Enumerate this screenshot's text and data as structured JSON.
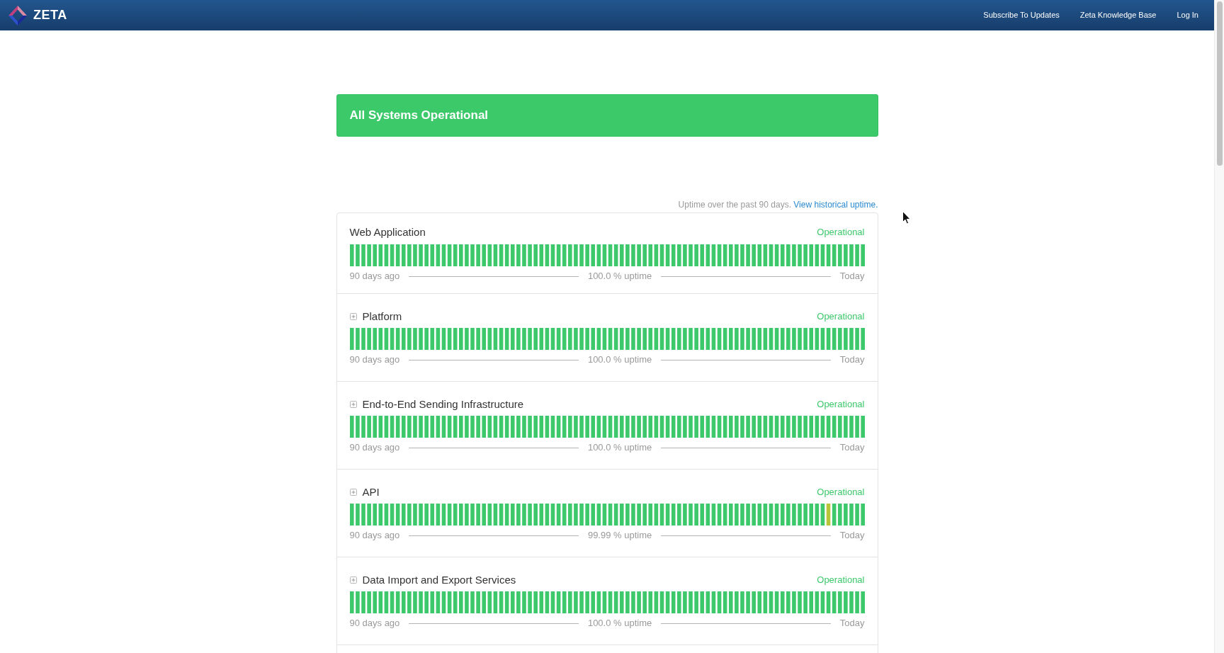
{
  "header": {
    "logo_text": "ZETA",
    "nav": [
      {
        "label": "Subscribe To Updates"
      },
      {
        "label": "Zeta Knowledge Base"
      },
      {
        "label": "Log In"
      }
    ]
  },
  "banner": {
    "text": "All Systems Operational"
  },
  "uptime_note": {
    "text": "Uptime over the past 90 days.",
    "link": "View historical uptime."
  },
  "components": [
    {
      "name": "Web Application",
      "expandable": false,
      "status": "Operational",
      "bars": [
        {
          "color": "#3dc86b"
        },
        {
          "color": "#3dc86b"
        },
        {
          "color": "#3dc86b"
        },
        {
          "color": "#3dc86b"
        },
        {
          "color": "#3dc86b"
        },
        {
          "color": "#3dc86b"
        },
        {
          "color": "#3dc86b"
        },
        {
          "color": "#3dc86b"
        },
        {
          "color": "#3dc86b"
        },
        {
          "color": "#3dc86b"
        },
        {
          "color": "#3dc86b"
        },
        {
          "color": "#3dc86b"
        },
        {
          "color": "#3dc86b"
        },
        {
          "color": "#3dc86b"
        },
        {
          "color": "#3dc86b"
        },
        {
          "color": "#3dc86b"
        },
        {
          "color": "#3dc86b"
        },
        {
          "color": "#3dc86b"
        },
        {
          "color": "#3dc86b"
        },
        {
          "color": "#3dc86b"
        },
        {
          "color": "#3dc86b"
        },
        {
          "color": "#3dc86b"
        },
        {
          "color": "#3dc86b"
        },
        {
          "color": "#3dc86b"
        },
        {
          "color": "#3dc86b"
        },
        {
          "color": "#3dc86b"
        },
        {
          "color": "#3dc86b"
        },
        {
          "color": "#3dc86b"
        },
        {
          "color": "#3dc86b"
        },
        {
          "color": "#3dc86b"
        },
        {
          "color": "#3dc86b"
        },
        {
          "color": "#3dc86b"
        },
        {
          "color": "#3dc86b"
        },
        {
          "color": "#3dc86b"
        },
        {
          "color": "#3dc86b"
        },
        {
          "color": "#3dc86b"
        },
        {
          "color": "#3dc86b"
        },
        {
          "color": "#3dc86b"
        },
        {
          "color": "#3dc86b"
        },
        {
          "color": "#3dc86b"
        },
        {
          "color": "#3dc86b"
        },
        {
          "color": "#3dc86b"
        },
        {
          "color": "#3dc86b"
        },
        {
          "color": "#3dc86b"
        },
        {
          "color": "#3dc86b"
        },
        {
          "color": "#3dc86b"
        },
        {
          "color": "#3dc86b"
        },
        {
          "color": "#3dc86b"
        },
        {
          "color": "#3dc86b"
        },
        {
          "color": "#3dc86b"
        },
        {
          "color": "#3dc86b"
        },
        {
          "color": "#3dc86b"
        },
        {
          "color": "#3dc86b"
        },
        {
          "color": "#3dc86b"
        },
        {
          "color": "#3dc86b"
        },
        {
          "color": "#3dc86b"
        },
        {
          "color": "#3dc86b"
        },
        {
          "color": "#3dc86b"
        },
        {
          "color": "#3dc86b"
        },
        {
          "color": "#3dc86b"
        },
        {
          "color": "#3dc86b"
        },
        {
          "color": "#3dc86b"
        },
        {
          "color": "#3dc86b"
        },
        {
          "color": "#3dc86b"
        },
        {
          "color": "#3dc86b"
        },
        {
          "color": "#3dc86b"
        },
        {
          "color": "#3dc86b"
        },
        {
          "color": "#3dc86b"
        },
        {
          "color": "#3dc86b"
        },
        {
          "color": "#3dc86b"
        },
        {
          "color": "#3dc86b"
        },
        {
          "color": "#3dc86b"
        },
        {
          "color": "#3dc86b"
        },
        {
          "color": "#3dc86b"
        },
        {
          "color": "#3dc86b"
        },
        {
          "color": "#3dc86b"
        },
        {
          "color": "#3dc86b"
        },
        {
          "color": "#3dc86b"
        },
        {
          "color": "#3dc86b"
        },
        {
          "color": "#3dc86b"
        },
        {
          "color": "#3dc86b"
        },
        {
          "color": "#3dc86b"
        },
        {
          "color": "#3dc86b"
        },
        {
          "color": "#3dc86b"
        },
        {
          "color": "#3dc86b"
        },
        {
          "color": "#3dc86b"
        },
        {
          "color": "#3dc86b"
        },
        {
          "color": "#3dc86b"
        },
        {
          "color": "#3dc86b"
        },
        {
          "color": "#3dc86b"
        }
      ],
      "start_label": "90 days ago",
      "uptime": "100.0 % uptime",
      "end_label": "Today"
    },
    {
      "name": "Platform",
      "expandable": true,
      "status": "Operational",
      "bars": [
        {
          "color": "#3dc86b"
        },
        {
          "color": "#3dc86b"
        },
        {
          "color": "#3dc86b"
        },
        {
          "color": "#3dc86b"
        },
        {
          "color": "#3dc86b"
        },
        {
          "color": "#3dc86b"
        },
        {
          "color": "#3dc86b"
        },
        {
          "color": "#3dc86b"
        },
        {
          "color": "#3dc86b"
        },
        {
          "color": "#3dc86b"
        },
        {
          "color": "#3dc86b"
        },
        {
          "color": "#3dc86b"
        },
        {
          "color": "#3dc86b"
        },
        {
          "color": "#3dc86b"
        },
        {
          "color": "#3dc86b"
        },
        {
          "color": "#3dc86b"
        },
        {
          "color": "#3dc86b"
        },
        {
          "color": "#3dc86b"
        },
        {
          "color": "#3dc86b"
        },
        {
          "color": "#3dc86b"
        },
        {
          "color": "#3dc86b"
        },
        {
          "color": "#3dc86b"
        },
        {
          "color": "#3dc86b"
        },
        {
          "color": "#3dc86b"
        },
        {
          "color": "#3dc86b"
        },
        {
          "color": "#3dc86b"
        },
        {
          "color": "#3dc86b"
        },
        {
          "color": "#3dc86b"
        },
        {
          "color": "#3dc86b"
        },
        {
          "color": "#3dc86b"
        },
        {
          "color": "#3dc86b"
        },
        {
          "color": "#3dc86b"
        },
        {
          "color": "#3dc86b"
        },
        {
          "color": "#3dc86b"
        },
        {
          "color": "#3dc86b"
        },
        {
          "color": "#3dc86b"
        },
        {
          "color": "#3dc86b"
        },
        {
          "color": "#3dc86b"
        },
        {
          "color": "#3dc86b"
        },
        {
          "color": "#3dc86b"
        },
        {
          "color": "#3dc86b"
        },
        {
          "color": "#3dc86b"
        },
        {
          "color": "#3dc86b"
        },
        {
          "color": "#3dc86b"
        },
        {
          "color": "#3dc86b"
        },
        {
          "color": "#3dc86b"
        },
        {
          "color": "#3dc86b"
        },
        {
          "color": "#3dc86b"
        },
        {
          "color": "#3dc86b"
        },
        {
          "color": "#3dc86b"
        },
        {
          "color": "#3dc86b"
        },
        {
          "color": "#3dc86b"
        },
        {
          "color": "#3dc86b"
        },
        {
          "color": "#3dc86b"
        },
        {
          "color": "#3dc86b"
        },
        {
          "color": "#3dc86b"
        },
        {
          "color": "#3dc86b"
        },
        {
          "color": "#3dc86b"
        },
        {
          "color": "#3dc86b"
        },
        {
          "color": "#3dc86b"
        },
        {
          "color": "#3dc86b"
        },
        {
          "color": "#3dc86b"
        },
        {
          "color": "#3dc86b"
        },
        {
          "color": "#3dc86b"
        },
        {
          "color": "#3dc86b"
        },
        {
          "color": "#3dc86b"
        },
        {
          "color": "#3dc86b"
        },
        {
          "color": "#3dc86b"
        },
        {
          "color": "#3dc86b"
        },
        {
          "color": "#3dc86b"
        },
        {
          "color": "#3dc86b"
        },
        {
          "color": "#3dc86b"
        },
        {
          "color": "#3dc86b"
        },
        {
          "color": "#3dc86b"
        },
        {
          "color": "#3dc86b"
        },
        {
          "color": "#3dc86b"
        },
        {
          "color": "#3dc86b"
        },
        {
          "color": "#3dc86b"
        },
        {
          "color": "#3dc86b"
        },
        {
          "color": "#3dc86b"
        },
        {
          "color": "#3dc86b"
        },
        {
          "color": "#3dc86b"
        },
        {
          "color": "#3dc86b"
        },
        {
          "color": "#3dc86b"
        },
        {
          "color": "#3dc86b"
        },
        {
          "color": "#3dc86b"
        },
        {
          "color": "#3dc86b"
        },
        {
          "color": "#3dc86b"
        },
        {
          "color": "#3dc86b"
        },
        {
          "color": "#3dc86b"
        }
      ],
      "start_label": "90 days ago",
      "uptime": "100.0 % uptime",
      "end_label": "Today"
    },
    {
      "name": "End-to-End Sending Infrastructure",
      "expandable": true,
      "status": "Operational",
      "bars": [
        {
          "color": "#3dc86b"
        },
        {
          "color": "#3dc86b"
        },
        {
          "color": "#3dc86b"
        },
        {
          "color": "#3dc86b"
        },
        {
          "color": "#3dc86b"
        },
        {
          "color": "#3dc86b"
        },
        {
          "color": "#3dc86b"
        },
        {
          "color": "#3dc86b"
        },
        {
          "color": "#3dc86b"
        },
        {
          "color": "#3dc86b"
        },
        {
          "color": "#3dc86b"
        },
        {
          "color": "#3dc86b"
        },
        {
          "color": "#3dc86b"
        },
        {
          "color": "#3dc86b"
        },
        {
          "color": "#3dc86b"
        },
        {
          "color": "#3dc86b"
        },
        {
          "color": "#3dc86b"
        },
        {
          "color": "#3dc86b"
        },
        {
          "color": "#3dc86b"
        },
        {
          "color": "#3dc86b"
        },
        {
          "color": "#3dc86b"
        },
        {
          "color": "#3dc86b"
        },
        {
          "color": "#3dc86b"
        },
        {
          "color": "#3dc86b"
        },
        {
          "color": "#3dc86b"
        },
        {
          "color": "#3dc86b"
        },
        {
          "color": "#3dc86b"
        },
        {
          "color": "#3dc86b"
        },
        {
          "color": "#3dc86b"
        },
        {
          "color": "#3dc86b"
        },
        {
          "color": "#3dc86b"
        },
        {
          "color": "#3dc86b"
        },
        {
          "color": "#3dc86b"
        },
        {
          "color": "#3dc86b"
        },
        {
          "color": "#3dc86b"
        },
        {
          "color": "#3dc86b"
        },
        {
          "color": "#3dc86b"
        },
        {
          "color": "#3dc86b"
        },
        {
          "color": "#3dc86b"
        },
        {
          "color": "#3dc86b"
        },
        {
          "color": "#3dc86b"
        },
        {
          "color": "#3dc86b"
        },
        {
          "color": "#3dc86b"
        },
        {
          "color": "#3dc86b"
        },
        {
          "color": "#3dc86b"
        },
        {
          "color": "#3dc86b"
        },
        {
          "color": "#3dc86b"
        },
        {
          "color": "#3dc86b"
        },
        {
          "color": "#3dc86b"
        },
        {
          "color": "#3dc86b"
        },
        {
          "color": "#3dc86b"
        },
        {
          "color": "#3dc86b"
        },
        {
          "color": "#3dc86b"
        },
        {
          "color": "#3dc86b"
        },
        {
          "color": "#3dc86b"
        },
        {
          "color": "#3dc86b"
        },
        {
          "color": "#3dc86b"
        },
        {
          "color": "#3dc86b"
        },
        {
          "color": "#3dc86b"
        },
        {
          "color": "#3dc86b"
        },
        {
          "color": "#3dc86b"
        },
        {
          "color": "#3dc86b"
        },
        {
          "color": "#3dc86b"
        },
        {
          "color": "#3dc86b"
        },
        {
          "color": "#3dc86b"
        },
        {
          "color": "#3dc86b"
        },
        {
          "color": "#3dc86b"
        },
        {
          "color": "#3dc86b"
        },
        {
          "color": "#3dc86b"
        },
        {
          "color": "#3dc86b"
        },
        {
          "color": "#3dc86b"
        },
        {
          "color": "#3dc86b"
        },
        {
          "color": "#3dc86b"
        },
        {
          "color": "#3dc86b"
        },
        {
          "color": "#3dc86b"
        },
        {
          "color": "#3dc86b"
        },
        {
          "color": "#3dc86b"
        },
        {
          "color": "#3dc86b"
        },
        {
          "color": "#3dc86b"
        },
        {
          "color": "#3dc86b"
        },
        {
          "color": "#3dc86b"
        },
        {
          "color": "#3dc86b"
        },
        {
          "color": "#3dc86b"
        },
        {
          "color": "#3dc86b"
        },
        {
          "color": "#3dc86b"
        },
        {
          "color": "#3dc86b"
        },
        {
          "color": "#3dc86b"
        },
        {
          "color": "#3dc86b"
        },
        {
          "color": "#3dc86b"
        },
        {
          "color": "#3dc86b"
        }
      ],
      "start_label": "90 days ago",
      "uptime": "100.0 % uptime",
      "end_label": "Today"
    },
    {
      "name": "API",
      "expandable": true,
      "status": "Operational",
      "bars": [
        {
          "color": "#3dc86b"
        },
        {
          "color": "#3dc86b"
        },
        {
          "color": "#3dc86b"
        },
        {
          "color": "#3dc86b"
        },
        {
          "color": "#3dc86b"
        },
        {
          "color": "#3dc86b"
        },
        {
          "color": "#3dc86b"
        },
        {
          "color": "#3dc86b"
        },
        {
          "color": "#3dc86b"
        },
        {
          "color": "#3dc86b"
        },
        {
          "color": "#3dc86b"
        },
        {
          "color": "#3dc86b"
        },
        {
          "color": "#3dc86b"
        },
        {
          "color": "#3dc86b"
        },
        {
          "color": "#3dc86b"
        },
        {
          "color": "#3dc86b"
        },
        {
          "color": "#3dc86b"
        },
        {
          "color": "#3dc86b"
        },
        {
          "color": "#3dc86b"
        },
        {
          "color": "#3dc86b"
        },
        {
          "color": "#3dc86b"
        },
        {
          "color": "#3dc86b"
        },
        {
          "color": "#3dc86b"
        },
        {
          "color": "#3dc86b"
        },
        {
          "color": "#3dc86b"
        },
        {
          "color": "#3dc86b"
        },
        {
          "color": "#3dc86b"
        },
        {
          "color": "#3dc86b"
        },
        {
          "color": "#3dc86b"
        },
        {
          "color": "#3dc86b"
        },
        {
          "color": "#3dc86b"
        },
        {
          "color": "#3dc86b"
        },
        {
          "color": "#3dc86b"
        },
        {
          "color": "#3dc86b"
        },
        {
          "color": "#3dc86b"
        },
        {
          "color": "#3dc86b"
        },
        {
          "color": "#3dc86b"
        },
        {
          "color": "#3dc86b"
        },
        {
          "color": "#3dc86b"
        },
        {
          "color": "#3dc86b"
        },
        {
          "color": "#3dc86b"
        },
        {
          "color": "#3dc86b"
        },
        {
          "color": "#3dc86b"
        },
        {
          "color": "#3dc86b"
        },
        {
          "color": "#3dc86b"
        },
        {
          "color": "#3dc86b"
        },
        {
          "color": "#3dc86b"
        },
        {
          "color": "#3dc86b"
        },
        {
          "color": "#3dc86b"
        },
        {
          "color": "#3dc86b"
        },
        {
          "color": "#3dc86b"
        },
        {
          "color": "#3dc86b"
        },
        {
          "color": "#3dc86b"
        },
        {
          "color": "#3dc86b"
        },
        {
          "color": "#3dc86b"
        },
        {
          "color": "#3dc86b"
        },
        {
          "color": "#3dc86b"
        },
        {
          "color": "#3dc86b"
        },
        {
          "color": "#3dc86b"
        },
        {
          "color": "#3dc86b"
        },
        {
          "color": "#3dc86b"
        },
        {
          "color": "#3dc86b"
        },
        {
          "color": "#3dc86b"
        },
        {
          "color": "#3dc86b"
        },
        {
          "color": "#3dc86b"
        },
        {
          "color": "#3dc86b"
        },
        {
          "color": "#3dc86b"
        },
        {
          "color": "#3dc86b"
        },
        {
          "color": "#3dc86b"
        },
        {
          "color": "#3dc86b"
        },
        {
          "color": "#3dc86b"
        },
        {
          "color": "#3dc86b"
        },
        {
          "color": "#3dc86b"
        },
        {
          "color": "#3dc86b"
        },
        {
          "color": "#3dc86b"
        },
        {
          "color": "#3dc86b"
        },
        {
          "color": "#3dc86b"
        },
        {
          "color": "#3dc86b"
        },
        {
          "color": "#3dc86b"
        },
        {
          "color": "#3dc86b"
        },
        {
          "color": "#3dc86b"
        },
        {
          "color": "#3dc86b"
        },
        {
          "color": "#3dc86b"
        },
        {
          "color": "#b8c43a"
        },
        {
          "color": "#3dc86b"
        },
        {
          "color": "#3dc86b"
        },
        {
          "color": "#3dc86b"
        },
        {
          "color": "#3dc86b"
        },
        {
          "color": "#3dc86b"
        },
        {
          "color": "#3dc86b"
        }
      ],
      "start_label": "90 days ago",
      "uptime": "99.99 % uptime",
      "end_label": "Today"
    },
    {
      "name": "Data Import and Export Services",
      "expandable": true,
      "status": "Operational",
      "bars": [
        {
          "color": "#3dc86b"
        },
        {
          "color": "#3dc86b"
        },
        {
          "color": "#3dc86b"
        },
        {
          "color": "#3dc86b"
        },
        {
          "color": "#3dc86b"
        },
        {
          "color": "#3dc86b"
        },
        {
          "color": "#3dc86b"
        },
        {
          "color": "#3dc86b"
        },
        {
          "color": "#3dc86b"
        },
        {
          "color": "#3dc86b"
        },
        {
          "color": "#3dc86b"
        },
        {
          "color": "#3dc86b"
        },
        {
          "color": "#3dc86b"
        },
        {
          "color": "#3dc86b"
        },
        {
          "color": "#3dc86b"
        },
        {
          "color": "#3dc86b"
        },
        {
          "color": "#3dc86b"
        },
        {
          "color": "#3dc86b"
        },
        {
          "color": "#3dc86b"
        },
        {
          "color": "#3dc86b"
        },
        {
          "color": "#3dc86b"
        },
        {
          "color": "#3dc86b"
        },
        {
          "color": "#3dc86b"
        },
        {
          "color": "#3dc86b"
        },
        {
          "color": "#3dc86b"
        },
        {
          "color": "#3dc86b"
        },
        {
          "color": "#3dc86b"
        },
        {
          "color": "#3dc86b"
        },
        {
          "color": "#3dc86b"
        },
        {
          "color": "#3dc86b"
        },
        {
          "color": "#3dc86b"
        },
        {
          "color": "#3dc86b"
        },
        {
          "color": "#3dc86b"
        },
        {
          "color": "#3dc86b"
        },
        {
          "color": "#3dc86b"
        },
        {
          "color": "#3dc86b"
        },
        {
          "color": "#3dc86b"
        },
        {
          "color": "#3dc86b"
        },
        {
          "color": "#3dc86b"
        },
        {
          "color": "#3dc86b"
        },
        {
          "color": "#3dc86b"
        },
        {
          "color": "#3dc86b"
        },
        {
          "color": "#3dc86b"
        },
        {
          "color": "#3dc86b"
        },
        {
          "color": "#3dc86b"
        },
        {
          "color": "#3dc86b"
        },
        {
          "color": "#3dc86b"
        },
        {
          "color": "#3dc86b"
        },
        {
          "color": "#3dc86b"
        },
        {
          "color": "#3dc86b"
        },
        {
          "color": "#3dc86b"
        },
        {
          "color": "#3dc86b"
        },
        {
          "color": "#3dc86b"
        },
        {
          "color": "#3dc86b"
        },
        {
          "color": "#3dc86b"
        },
        {
          "color": "#3dc86b"
        },
        {
          "color": "#3dc86b"
        },
        {
          "color": "#3dc86b"
        },
        {
          "color": "#3dc86b"
        },
        {
          "color": "#3dc86b"
        },
        {
          "color": "#3dc86b"
        },
        {
          "color": "#3dc86b"
        },
        {
          "color": "#3dc86b"
        },
        {
          "color": "#3dc86b"
        },
        {
          "color": "#3dc86b"
        },
        {
          "color": "#3dc86b"
        },
        {
          "color": "#3dc86b"
        },
        {
          "color": "#3dc86b"
        },
        {
          "color": "#3dc86b"
        },
        {
          "color": "#3dc86b"
        },
        {
          "color": "#3dc86b"
        },
        {
          "color": "#3dc86b"
        },
        {
          "color": "#3dc86b"
        },
        {
          "color": "#3dc86b"
        },
        {
          "color": "#3dc86b"
        },
        {
          "color": "#3dc86b"
        },
        {
          "color": "#3dc86b"
        },
        {
          "color": "#3dc86b"
        },
        {
          "color": "#3dc86b"
        },
        {
          "color": "#3dc86b"
        },
        {
          "color": "#3dc86b"
        },
        {
          "color": "#3dc86b"
        },
        {
          "color": "#3dc86b"
        },
        {
          "color": "#3dc86b"
        },
        {
          "color": "#3dc86b"
        },
        {
          "color": "#3dc86b"
        },
        {
          "color": "#3dc86b"
        },
        {
          "color": "#3dc86b"
        },
        {
          "color": "#3dc86b"
        },
        {
          "color": "#3dc86b"
        }
      ],
      "start_label": "90 days ago",
      "uptime": "100.0 % uptime",
      "end_label": "Today"
    }
  ]
}
